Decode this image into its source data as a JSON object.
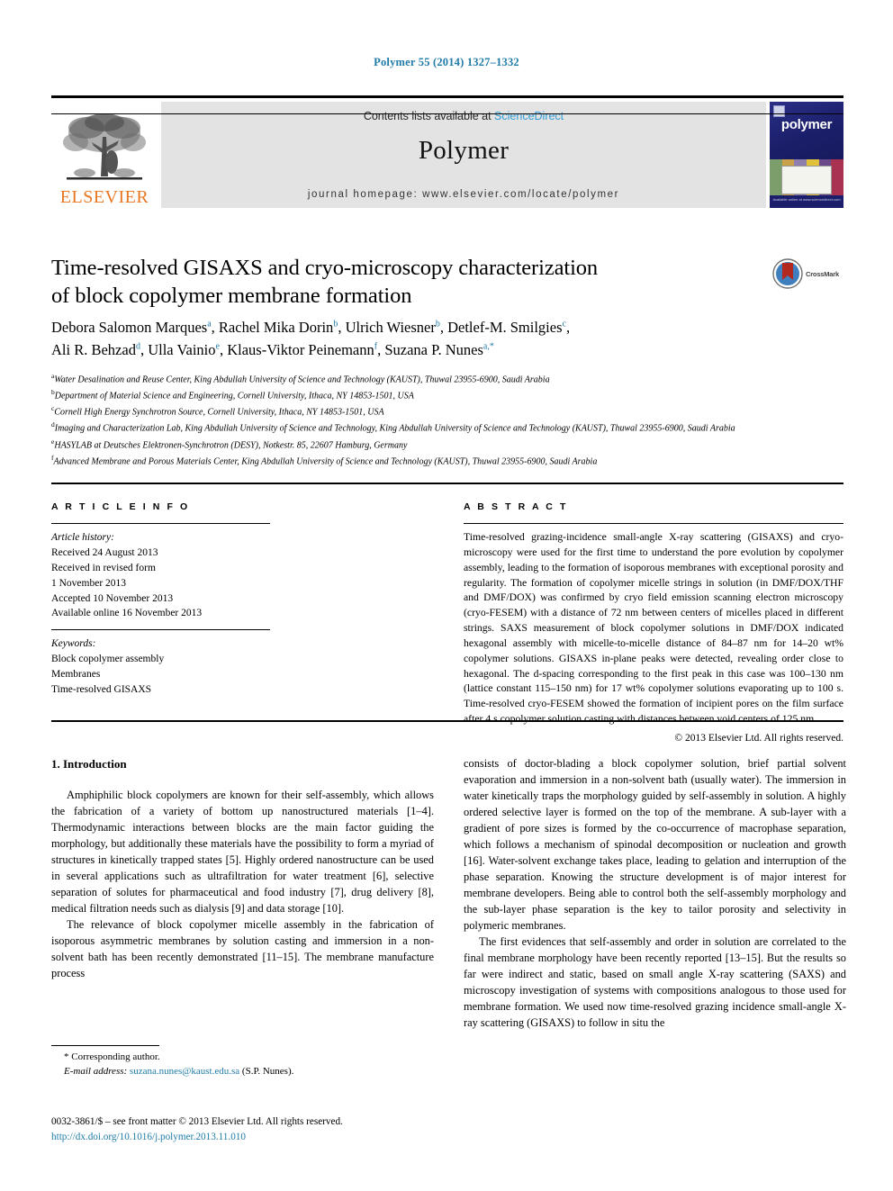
{
  "running_head": "Polymer 55 (2014) 1327–1332",
  "masthead": {
    "publisher": "ELSEVIER",
    "contents_prefix": "Contents lists available at ",
    "contents_link": "ScienceDirect",
    "journal_name": "Polymer",
    "homepage": "journal homepage: www.elsevier.com/locate/polymer",
    "cover_title": "polymer",
    "cover_footer": "Available online at www.sciencedirect.com"
  },
  "crossmark": {
    "label": "CrossMark"
  },
  "article": {
    "title_line1": "Time-resolved GISAXS and cryo-microscopy characterization",
    "title_line2": "of block copolymer membrane formation",
    "authors": [
      {
        "name": "Debora Salomon Marques",
        "sup": "a"
      },
      {
        "name": "Rachel Mika Dorin",
        "sup": "b"
      },
      {
        "name": "Ulrich Wiesner",
        "sup": "b"
      },
      {
        "name": "Detlef-M. Smilgies",
        "sup": "c"
      },
      {
        "name": "Ali R. Behzad",
        "sup": "d"
      },
      {
        "name": "Ulla Vainio",
        "sup": "e"
      },
      {
        "name": "Klaus-Viktor Peinemann",
        "sup": "f"
      },
      {
        "name": "Suzana P. Nunes",
        "sup": "a,*"
      }
    ],
    "affiliations": [
      {
        "mark": "a",
        "text": "Water Desalination and Reuse Center, King Abdullah University of Science and Technology (KAUST), Thuwal 23955-6900, Saudi Arabia"
      },
      {
        "mark": "b",
        "text": "Department of Material Science and Engineering, Cornell University, Ithaca, NY 14853-1501, USA"
      },
      {
        "mark": "c",
        "text": "Cornell High Energy Synchrotron Source, Cornell University, Ithaca, NY 14853-1501, USA"
      },
      {
        "mark": "d",
        "text": "Imaging and Characterization Lab, King Abdullah University of Science and Technology, King Abdullah University of Science and Technology (KAUST), Thuwal 23955-6900, Saudi Arabia"
      },
      {
        "mark": "e",
        "text": "HASYLAB at Deutsches Elektronen-Synchrotron (DESY), Notkestr. 85, 22607 Hamburg, Germany"
      },
      {
        "mark": "f",
        "text": "Advanced Membrane and Porous Materials Center, King Abdullah University of Science and Technology (KAUST), Thuwal 23955-6900, Saudi Arabia"
      }
    ]
  },
  "info_section": {
    "heading": "A R T I C L E    I N F O",
    "history_label": "Article history:",
    "history": [
      "Received 24 August 2013",
      "Received in revised form",
      "1 November 2013",
      "Accepted 10 November 2013",
      "Available online 16 November 2013"
    ],
    "keywords_label": "Keywords:",
    "keywords": [
      "Block copolymer assembly",
      "Membranes",
      "Time-resolved GISAXS"
    ]
  },
  "abstract_section": {
    "heading": "A B S T R A C T",
    "text": "Time-resolved grazing-incidence small-angle X-ray scattering (GISAXS) and cryo-microscopy were used for the first time to understand the pore evolution by copolymer assembly, leading to the formation of isoporous membranes with exceptional porosity and regularity. The formation of copolymer micelle strings in solution (in DMF/DOX/THF and DMF/DOX) was confirmed by cryo field emission scanning electron microscopy (cryo-FESEM) with a distance of 72 nm between centers of micelles placed in different strings. SAXS measurement of block copolymer solutions in DMF/DOX indicated hexagonal assembly with micelle-to-micelle distance of 84–87 nm for 14–20 wt% copolymer solutions. GISAXS in-plane peaks were detected, revealing order close to hexagonal. The d-spacing corresponding to the first peak in this case was 100–130 nm (lattice constant 115–150 nm) for 17 wt% copolymer solutions evaporating up to 100 s. Time-resolved cryo-FESEM showed the formation of incipient pores on the film surface after 4 s copolymer solution casting with distances between void centers of 125 nm.",
    "copyright": "© 2013 Elsevier Ltd. All rights reserved."
  },
  "body": {
    "section_number_title": "1.  Introduction",
    "left_paragraph_1": "Amphiphilic block copolymers are known for their self-assembly, which allows the fabrication of a variety of bottom up nanostructured materials [1–4]. Thermodynamic interactions between blocks are the main factor guiding the morphology, but additionally these materials have the possibility to form a myriad of structures in kinetically trapped states [5]. Highly ordered nanostructure can be used in several applications such as ultrafiltration for water treatment [6], selective separation of solutes for pharmaceutical and food industry [7], drug delivery [8], medical filtration needs such as dialysis [9] and data storage [10].",
    "left_paragraph_2": "The relevance of block copolymer micelle assembly in the fabrication of isoporous asymmetric membranes by solution casting and immersion in a non-solvent bath has been recently demonstrated [11–15]. The membrane manufacture process",
    "right_paragraph_1": "consists of doctor-blading a block copolymer solution, brief partial solvent evaporation and immersion in a non-solvent bath (usually water). The immersion in water kinetically traps the morphology guided by self-assembly in solution. A highly ordered selective layer is formed on the top of the membrane. A sub-layer with a gradient of pore sizes is formed by the co-occurrence of macrophase separation, which follows a mechanism of spinodal decomposition or nucleation and growth [16]. Water-solvent exchange takes place, leading to gelation and interruption of the phase separation. Knowing the structure development is of major interest for membrane developers. Being able to control both the self-assembly morphology and the sub-layer phase separation is the key to tailor porosity and selectivity in polymeric membranes.",
    "right_paragraph_2": "The first evidences that self-assembly and order in solution are correlated to the final membrane morphology have been recently reported [13–15]. But the results so far were indirect and static, based on small angle X-ray scattering (SAXS) and microscopy investigation of systems with compositions analogous to those used for membrane formation. We used now time-resolved grazing incidence small-angle X-ray scattering (GISAXS) to follow in situ the"
  },
  "footnotes": {
    "corresponding_author": "* Corresponding author.",
    "email_label": "E-mail address:",
    "email": "suzana.nunes@kaust.edu.sa",
    "email_suffix": "(S.P. Nunes)."
  },
  "imprint": {
    "line1": "0032-3861/$ – see front matter © 2013 Elsevier Ltd. All rights reserved.",
    "doi": "http://dx.doi.org/10.1016/j.polymer.2013.11.010"
  },
  "colors": {
    "accent_blue": "#1f7ba8",
    "elsevier_orange": "#E87722",
    "masthead_grey": "#e3e3e3",
    "cover_navy": "#1b1f6b",
    "crossmark_red": "#b3281e"
  }
}
